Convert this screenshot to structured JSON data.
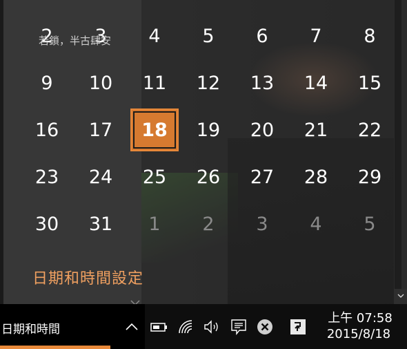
{
  "calendar": {
    "weeks": [
      [
        {
          "d": "2"
        },
        {
          "d": "3"
        },
        {
          "d": "4"
        },
        {
          "d": "5"
        },
        {
          "d": "6"
        },
        {
          "d": "7"
        },
        {
          "d": "8"
        }
      ],
      [
        {
          "d": "9"
        },
        {
          "d": "10"
        },
        {
          "d": "11"
        },
        {
          "d": "12"
        },
        {
          "d": "13"
        },
        {
          "d": "14"
        },
        {
          "d": "15"
        }
      ],
      [
        {
          "d": "16"
        },
        {
          "d": "17"
        },
        {
          "d": "18",
          "today": true
        },
        {
          "d": "19"
        },
        {
          "d": "20"
        },
        {
          "d": "21"
        },
        {
          "d": "22"
        }
      ],
      [
        {
          "d": "23"
        },
        {
          "d": "24"
        },
        {
          "d": "25"
        },
        {
          "d": "26"
        },
        {
          "d": "27"
        },
        {
          "d": "28"
        },
        {
          "d": "29"
        }
      ],
      [
        {
          "d": "30"
        },
        {
          "d": "31"
        },
        {
          "d": "1",
          "dim": true
        },
        {
          "d": "2",
          "dim": true
        },
        {
          "d": "3",
          "dim": true
        },
        {
          "d": "4",
          "dim": true
        },
        {
          "d": "5",
          "dim": true
        }
      ]
    ],
    "settings_link": "日期和時間設定",
    "today_color": "#d67a30"
  },
  "taskbar": {
    "window_title": "日期和時間",
    "under_text": "若鎖，半古肆安",
    "clock_time": "上午 07:58",
    "clock_date": "2015/8/18"
  },
  "tray_icons": [
    "chevron-up-icon",
    "battery-icon",
    "wifi-icon",
    "volume-icon",
    "action-center-icon",
    "close-circle-icon",
    "ime-icon"
  ],
  "colors": {
    "accent": "#e8893a",
    "link": "#f0a060"
  }
}
